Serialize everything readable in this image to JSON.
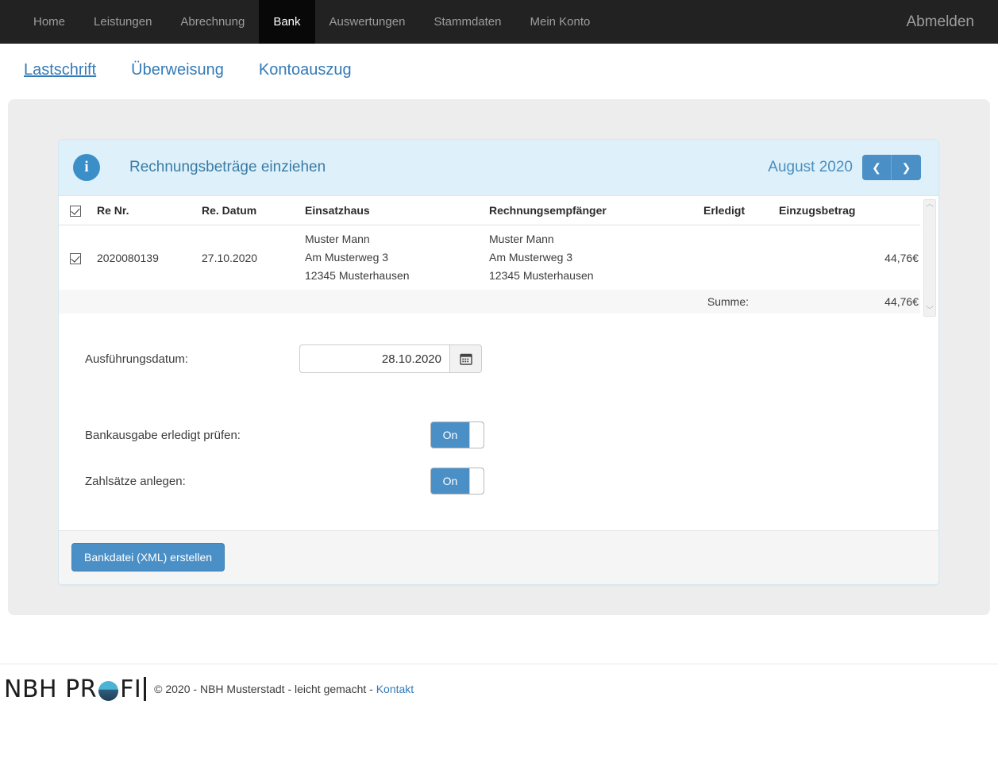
{
  "navbar": {
    "items": [
      {
        "label": "Home",
        "active": false
      },
      {
        "label": "Leistungen",
        "active": false
      },
      {
        "label": "Abrechnung",
        "active": false
      },
      {
        "label": "Bank",
        "active": true
      },
      {
        "label": "Auswertungen",
        "active": false
      },
      {
        "label": "Stammdaten",
        "active": false
      },
      {
        "label": "Mein Konto",
        "active": false
      }
    ],
    "logout_label": "Abmelden",
    "bg_color": "#222222",
    "active_bg_color": "#080808"
  },
  "subnav": {
    "items": [
      {
        "label": "Lastschrift",
        "active": true
      },
      {
        "label": "Überweisung",
        "active": false
      },
      {
        "label": "Kontoauszug",
        "active": false
      }
    ],
    "link_color": "#337ab7"
  },
  "panel": {
    "icon": "info-icon",
    "icon_glyph": "i",
    "title": "Rechnungsbeträge einziehen",
    "heading_bg": "#def0fa",
    "month_label": "August 2020",
    "prev_glyph": "❮",
    "next_glyph": "❯",
    "accent_color": "#4a90c7"
  },
  "table": {
    "select_all_checked": true,
    "columns": [
      {
        "key": "check",
        "label": ""
      },
      {
        "key": "renr",
        "label": "Re Nr."
      },
      {
        "key": "date",
        "label": "Re. Datum"
      },
      {
        "key": "haus",
        "label": "Einsatzhaus"
      },
      {
        "key": "empf",
        "label": "Rechnungsempfänger"
      },
      {
        "key": "erledigt",
        "label": "Erledigt"
      },
      {
        "key": "betrag",
        "label": "Einzugsbetrag"
      }
    ],
    "rows": [
      {
        "checked": true,
        "renr": "2020080139",
        "date": "27.10.2020",
        "haus_line1": "Muster Mann",
        "haus_line2": "Am Musterweg 3",
        "haus_line3": "12345 Musterhausen",
        "empf_line1": "Muster Mann",
        "empf_line2": "Am Musterweg 3",
        "empf_line3": "12345 Musterhausen",
        "erledigt": "",
        "betrag": "44,76€"
      }
    ],
    "summary_label": "Summe:",
    "summary_value": "44,76€",
    "scroll_up_glyph": "︿",
    "scroll_down_glyph": "﹀"
  },
  "form": {
    "date_label": "Ausführungsdatum:",
    "date_value": "28.10.2020",
    "date_placeholder": "TT.MM.JJJJ",
    "calendar_icon": "calendar-icon",
    "toggle1_label": "Bankausgabe erledigt prüfen:",
    "toggle1_state": "On",
    "toggle2_label": "Zahlsätze anlegen:",
    "toggle2_state": "On"
  },
  "panel_footer": {
    "submit_label": "Bankdatei (XML) erstellen"
  },
  "site_footer": {
    "logo_part1": "NBH PR",
    "logo_part2": "FI",
    "copyright": "© 2020 - NBH Musterstadt - leicht gemacht - ",
    "contact_label": "Kontakt"
  }
}
